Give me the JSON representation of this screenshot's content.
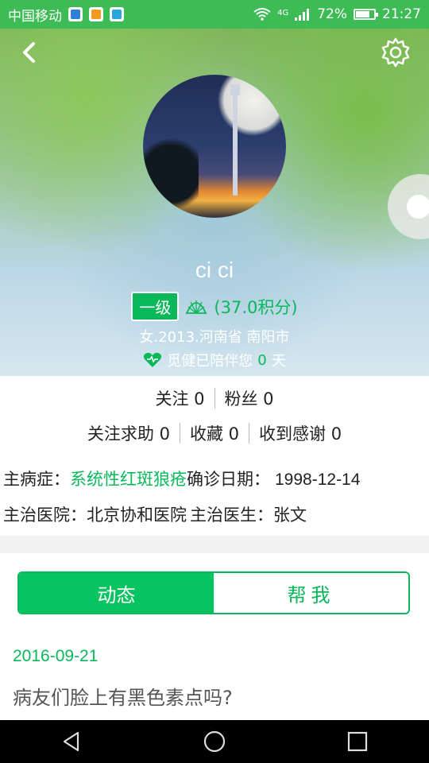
{
  "status_bar": {
    "carrier": "中国移动",
    "network": "4G",
    "battery": "72%",
    "time": "21:27"
  },
  "profile": {
    "username": "ci ci",
    "level": "一级",
    "points": "(37.0积分)",
    "info": "女.2013.河南省 南阳市",
    "accompany_prefix": "觅健已陪伴您",
    "accompany_days": "0",
    "accompany_suffix": "天"
  },
  "stats": {
    "follow": "关注 0",
    "fans": "粉丝 0",
    "follow_help": "关注求助 0",
    "favorites": "收藏 0",
    "thanks": "收到感谢 0"
  },
  "medical": {
    "disease_label": "主病症：",
    "disease_value": "系统性红斑狼疮",
    "diagnosis_label": "确诊日期：",
    "diagnosis_date": "1998-12-14",
    "hospital_label": "主治医院：",
    "hospital_value": "北京协和医院",
    "doctor_label": "主治医生：",
    "doctor_value": "张文"
  },
  "tabs": {
    "active": "动态",
    "inactive": "帮我"
  },
  "post": {
    "date": "2016-09-21",
    "title": "病友们脸上有黑色素点吗?"
  },
  "icons": {
    "back": "chevron-left-icon",
    "settings": "gear-icon",
    "shell": "shell-icon",
    "heart": "heart-icon"
  },
  "colors": {
    "accent": "#08b85a",
    "statusbar": "#3dbb55"
  }
}
